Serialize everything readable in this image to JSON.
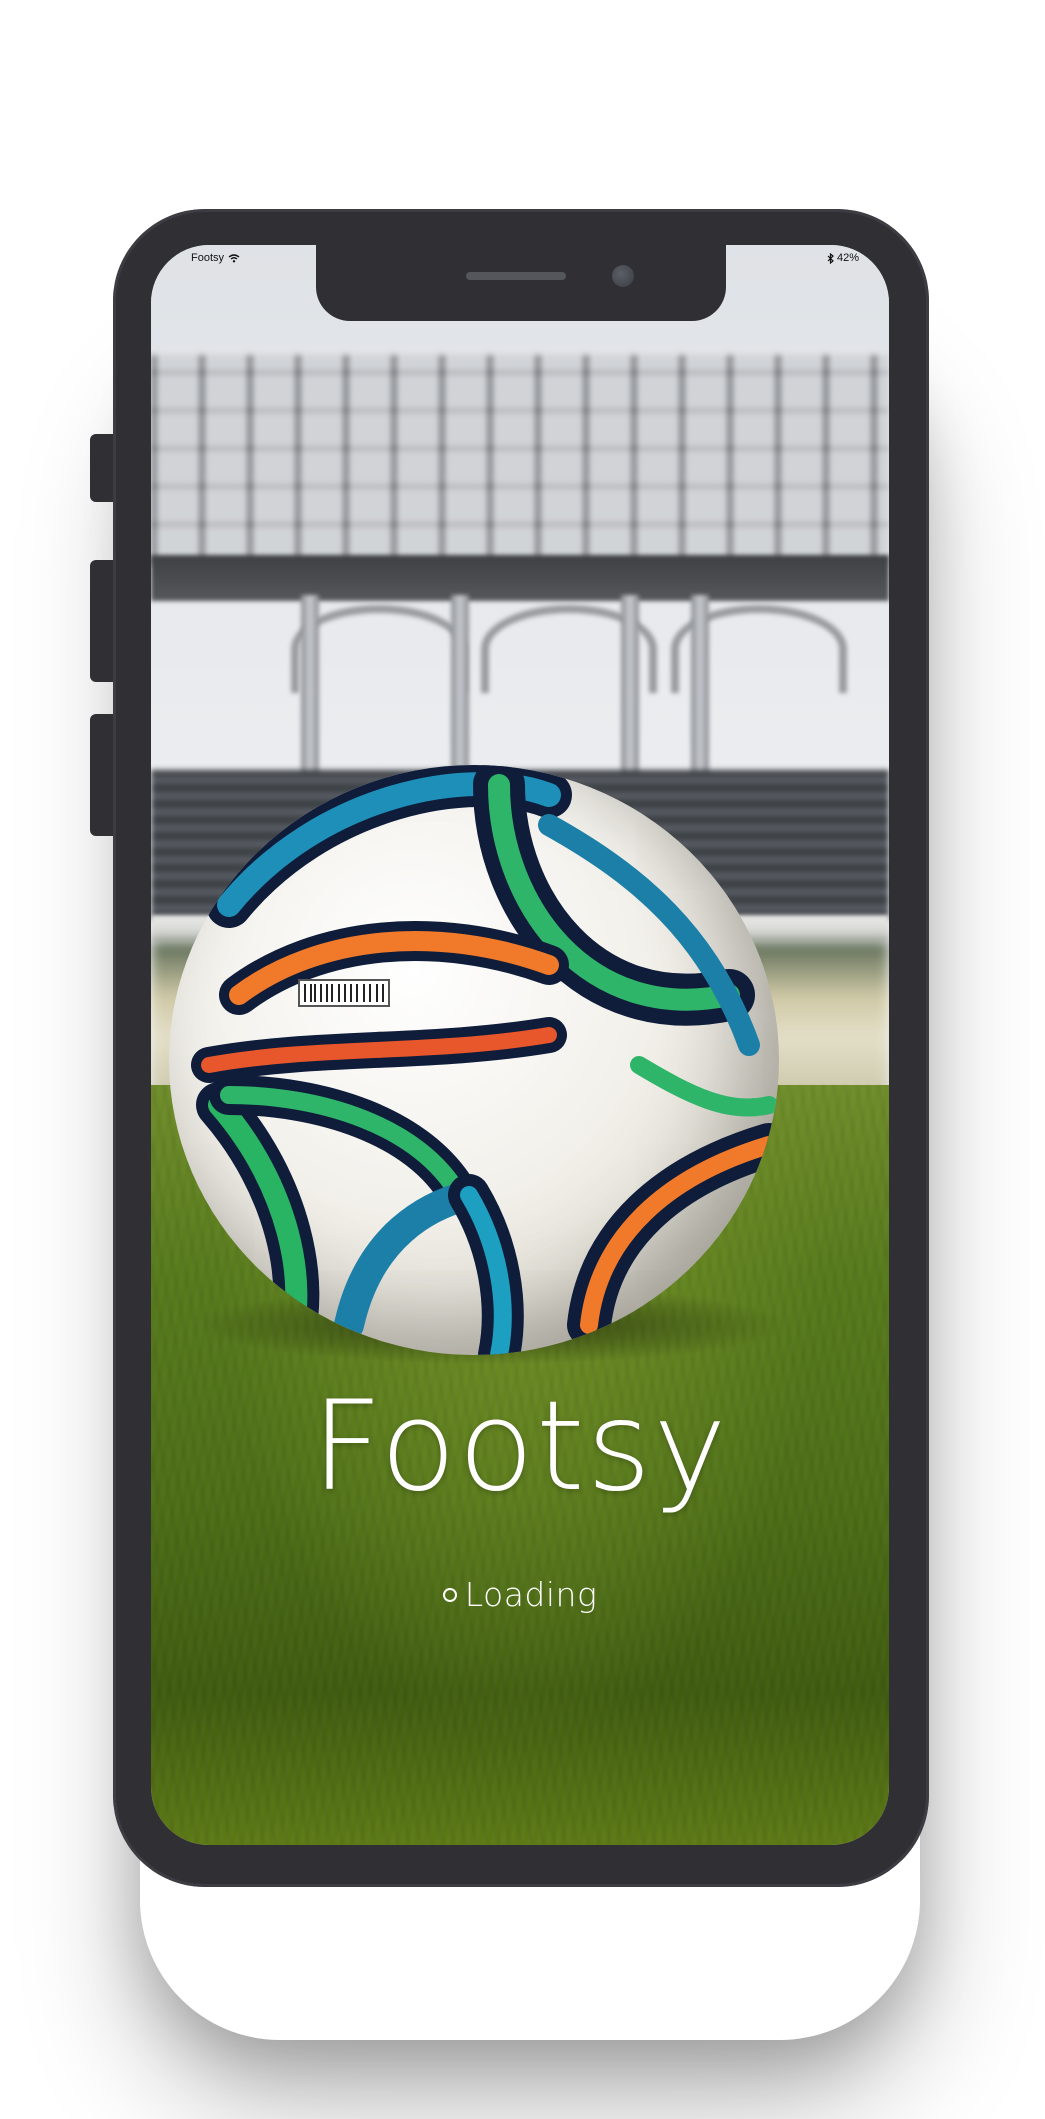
{
  "status_bar": {
    "carrier": "Footsy",
    "wifi_icon": "wifi-icon",
    "bluetooth_icon": "bluetooth-icon",
    "battery_text": "42%"
  },
  "splash": {
    "app_name": "Footsy",
    "loading_label": "Loading",
    "spinner_icon": "loading-spinner-icon",
    "background_image": "soccer-ball-on-stadium-grass"
  },
  "device": {
    "frame_color": "#2f2f34"
  }
}
